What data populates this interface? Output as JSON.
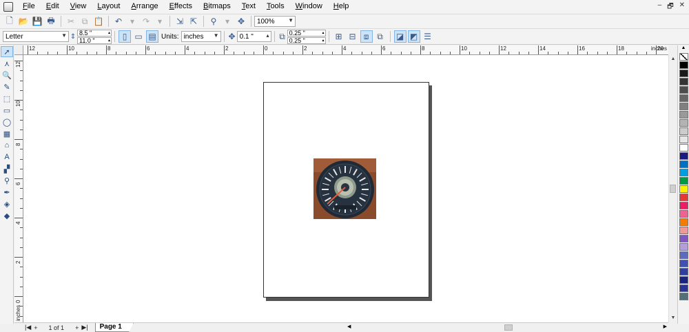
{
  "menu": [
    "File",
    "Edit",
    "View",
    "Layout",
    "Arrange",
    "Effects",
    "Bitmaps",
    "Text",
    "Tools",
    "Window",
    "Help"
  ],
  "window_controls": [
    "–",
    "🗗",
    "✕"
  ],
  "toolbar": {
    "zoom": "100%"
  },
  "propertybar": {
    "paper_size": "Letter",
    "width": "8.5 \"",
    "height": "11.0 \"",
    "units_label": "Units:",
    "units": "inches",
    "nudge": "0.1 \"",
    "dup_x": "0.25 \"",
    "dup_y": "0.25 \""
  },
  "ruler": {
    "unit": "inches",
    "h_labels": [
      "12",
      "10",
      "8",
      "6",
      "4",
      "2",
      "0",
      "2",
      "4",
      "6",
      "8",
      "10",
      "12",
      "14",
      "16",
      "18",
      "20"
    ],
    "v_labels": [
      "12",
      "10",
      "8",
      "6",
      "4",
      "2",
      "0"
    ],
    "v_unit": "inches"
  },
  "bottom": {
    "page_count": "1 of 1",
    "page_tab": "Page 1"
  },
  "palette": [
    "#ffffff",
    "#000000",
    "#1a1a1a",
    "#333333",
    "#4d4d4d",
    "#666666",
    "#808080",
    "#999999",
    "#b3b3b3",
    "#cccccc",
    "#e6e6e6",
    "#ffffff",
    "#1a1a80",
    "#0070c0",
    "#00a0e0",
    "#009944",
    "#fff200",
    "#e53935",
    "#e91e63",
    "#f06292",
    "#f57c00",
    "#ef9a9a",
    "#7e57c2",
    "#b39ddb",
    "#5c6bc0",
    "#3f51b5",
    "#303f9f",
    "#1a237e",
    "#283593",
    "#546e7a"
  ]
}
